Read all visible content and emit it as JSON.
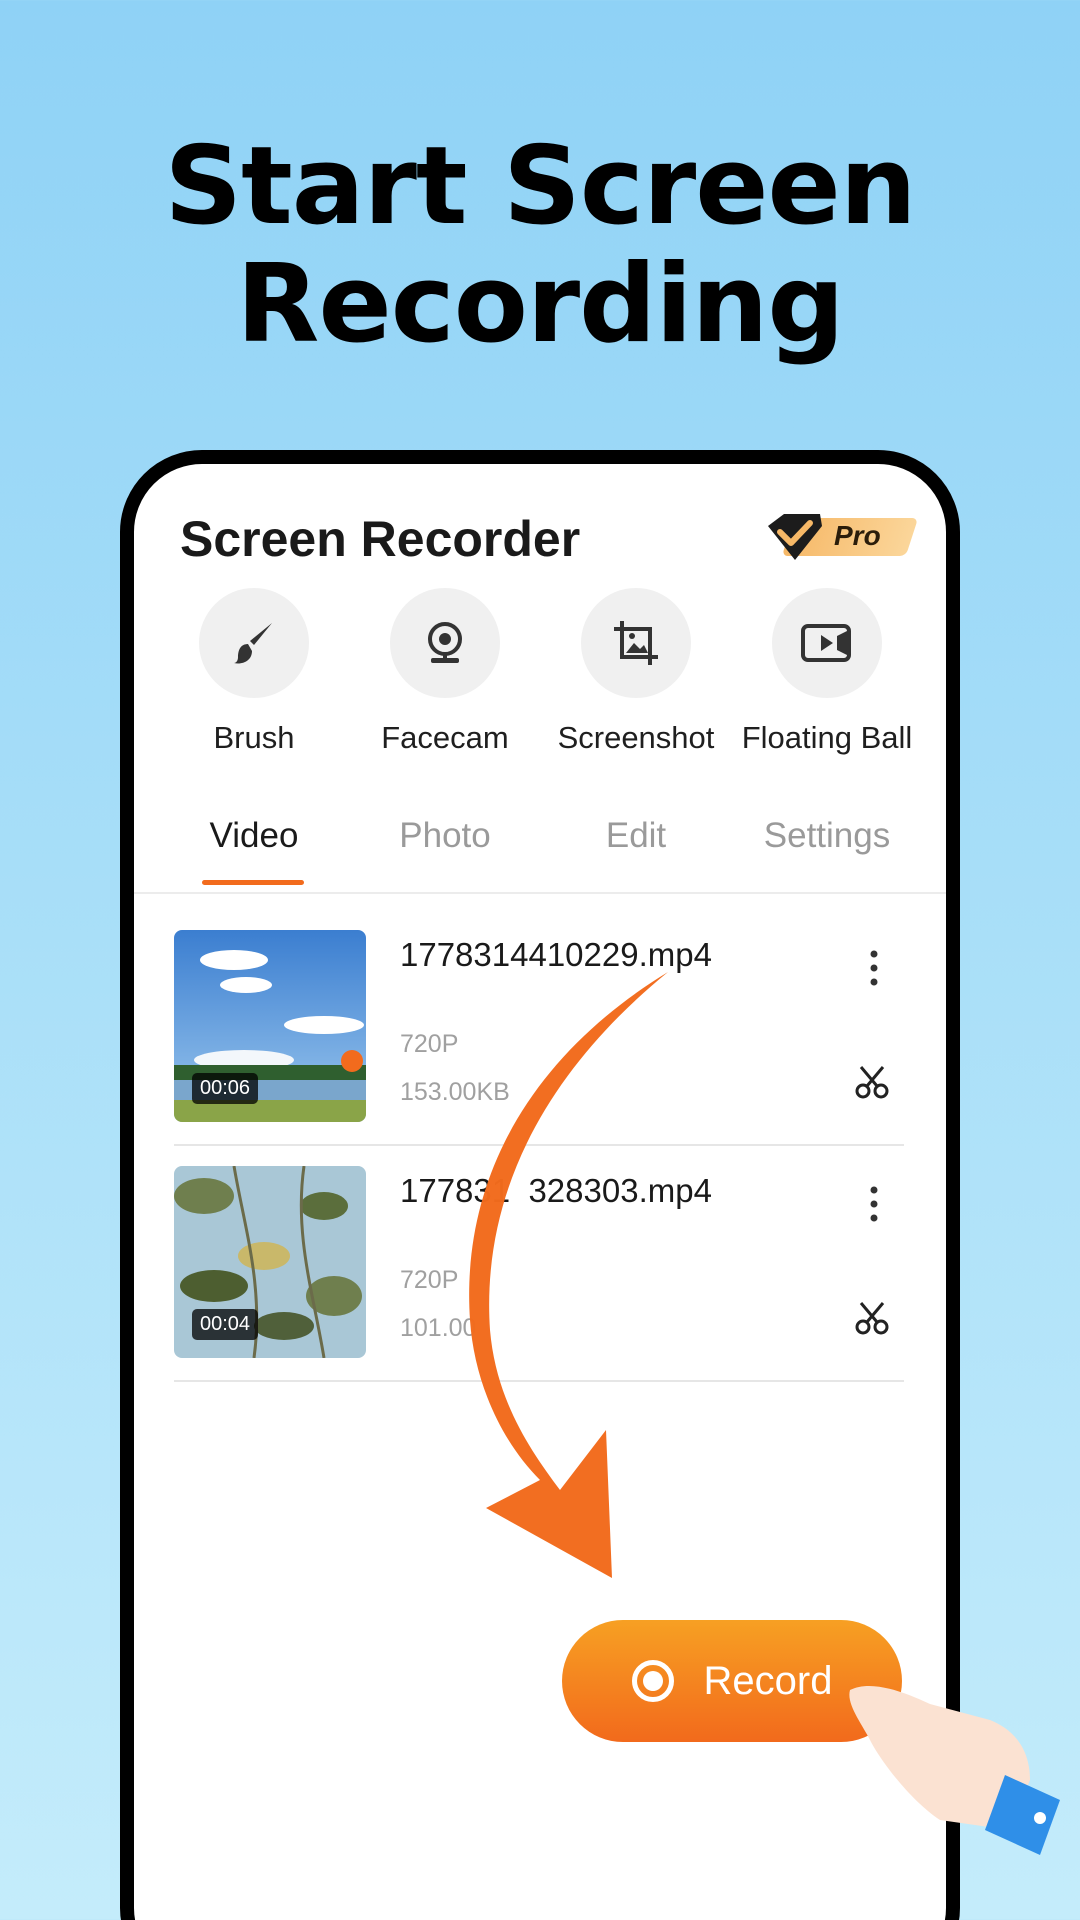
{
  "headline": {
    "line1": "Start Screen",
    "line2": "Recording"
  },
  "app": {
    "title": "Screen Recorder",
    "pro_label": "Pro",
    "accent": "#f26b1d"
  },
  "tools": [
    {
      "label": "Brush",
      "icon": "brush-icon"
    },
    {
      "label": "Facecam",
      "icon": "webcam-icon"
    },
    {
      "label": "Screenshot",
      "icon": "screenshot-icon"
    },
    {
      "label": "Floating Ball",
      "icon": "video-camera-icon"
    }
  ],
  "tabs": [
    {
      "label": "Video",
      "active": true
    },
    {
      "label": "Photo",
      "active": false
    },
    {
      "label": "Edit",
      "active": false
    },
    {
      "label": "Settings",
      "active": false
    }
  ],
  "files": [
    {
      "name": "1778314410229.mp4",
      "duration": "00:06",
      "resolution": "720P",
      "size": "153.00KB"
    },
    {
      "name": "177831  328303.mp4",
      "duration": "00:04",
      "resolution": "720P",
      "size": "101.00"
    }
  ],
  "record_button": {
    "label": "Record"
  }
}
